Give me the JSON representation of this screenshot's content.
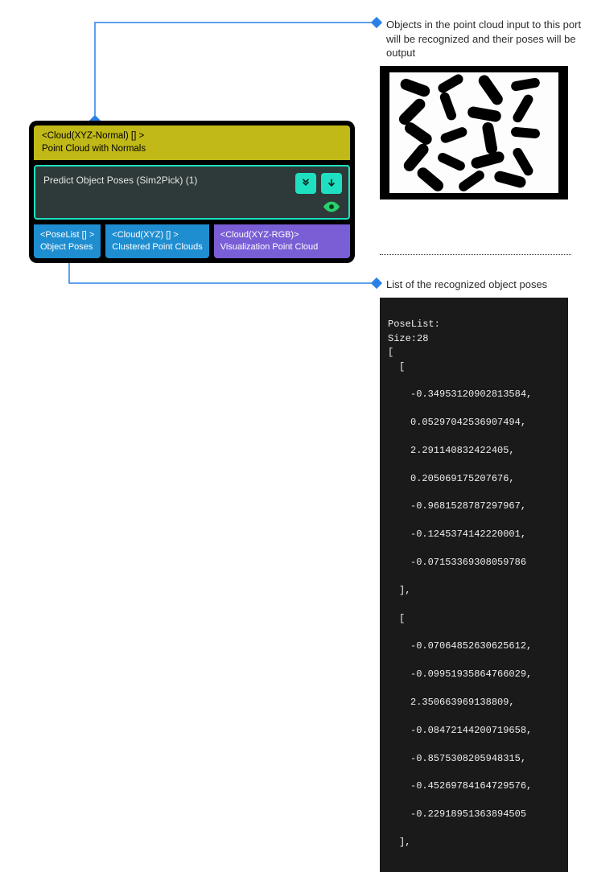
{
  "annotations": {
    "top": "Objects in the point cloud input to this port will be recognized and their poses will be output",
    "bottom": "List of the recognized object poses"
  },
  "node": {
    "input": {
      "type_label": "<Cloud(XYZ-Normal) [] >",
      "name_label": "Point Cloud with Normals"
    },
    "title": "Predict Object Poses (Sim2Pick) (1)",
    "outputs": [
      {
        "type_label": "<PoseList [] >",
        "name_label": "Object Poses"
      },
      {
        "type_label": "<Cloud(XYZ) [] >",
        "name_label": "Clustered Point Clouds"
      },
      {
        "type_label": "<Cloud(XYZ-RGB)>",
        "name_label": "Visualization Point Cloud"
      }
    ]
  },
  "pose_output": {
    "header": "PoseList:",
    "size_label": "Size:28",
    "open": "[",
    "entries": [
      [
        "-0.34953120902813584",
        "0.05297042536907494",
        "2.291140832422405",
        "0.205069175207676",
        "-0.9681528787297967",
        "-0.1245374142220001",
        "-0.07153369308059786"
      ],
      [
        "-0.07064852630625612",
        "-0.09951935864766029",
        "2.350663969138809",
        "-0.08472144200719658",
        "-0.8575308205948315",
        "-0.45269784164729576",
        "-0.22918951363894505"
      ]
    ]
  }
}
